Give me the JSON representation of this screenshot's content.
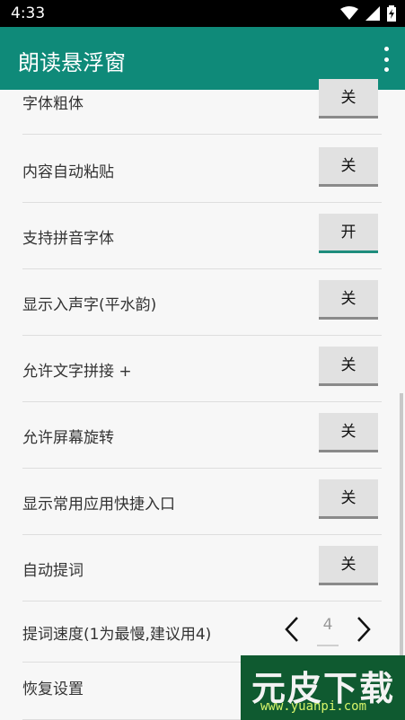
{
  "status_bar": {
    "time": "4:33"
  },
  "app_bar": {
    "title": "朗读悬浮窗",
    "more_icon": "more-vert-icon"
  },
  "settings": [
    {
      "label": "字体粗体",
      "state": "关",
      "on": false
    },
    {
      "label": "内容自动粘贴",
      "state": "关",
      "on": false
    },
    {
      "label": "支持拼音字体",
      "state": "开",
      "on": true
    },
    {
      "label": "显示入声字(平水韵)",
      "state": "关",
      "on": false
    },
    {
      "label": "允许文字拼接 +",
      "state": "关",
      "on": false
    },
    {
      "label": "允许屏幕旋转",
      "state": "关",
      "on": false
    },
    {
      "label": "显示常用应用快捷入口",
      "state": "关",
      "on": false
    },
    {
      "label": "自动提词",
      "state": "关",
      "on": false
    }
  ],
  "speed": {
    "label": "提词速度(1为最慢,建议用4)",
    "value": "4"
  },
  "reset": {
    "label": "恢复设置"
  },
  "watermark": {
    "main": "元皮下载",
    "sub": "www.yuanpi.com"
  },
  "colors": {
    "accent": "#0f8a79",
    "toggle_on_underline": "#1e8d7d",
    "background": "#f7f7f7"
  }
}
